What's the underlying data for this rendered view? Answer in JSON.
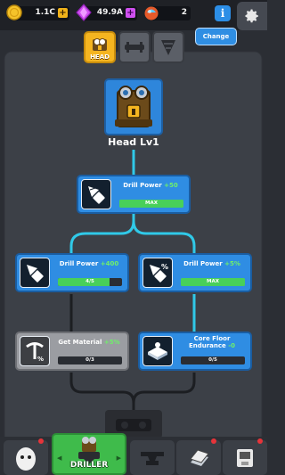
{
  "resources": {
    "coins": "1.1C",
    "gems": "49.9A",
    "fuel": "2"
  },
  "header": {
    "info_label": "i",
    "change_label": "Change"
  },
  "tabs": [
    {
      "id": "head",
      "label": "HEAD",
      "active": true
    },
    {
      "id": "body",
      "label": "",
      "active": false
    },
    {
      "id": "drill",
      "label": "",
      "active": false
    }
  ],
  "head": {
    "title": "Head Lv1"
  },
  "nodes": [
    {
      "name": "Drill Power",
      "bonus": "+50",
      "bar_text": "MAX",
      "progress": 1.0
    },
    {
      "name": "Drill Power",
      "bonus": "+400",
      "bar_text": "4/5",
      "progress": 0.8
    },
    {
      "name": "Drill Power",
      "bonus": "+5%",
      "bar_text": "MAX",
      "progress": 1.0
    },
    {
      "name": "Get Material",
      "bonus": "+5%",
      "bar_text": "0/3",
      "progress": 0.0
    },
    {
      "name": "Core Floor Endurance",
      "bonus": "-0",
      "bar_text": "0/5",
      "progress": 0.0
    }
  ],
  "bottom_nav": {
    "active_label": "DRILLER"
  },
  "colors": {
    "accent_blue": "#2f8de3",
    "accent_gold": "#f5b520",
    "accent_green": "#3fbb4b",
    "connector_cyan": "#30c9e8"
  }
}
